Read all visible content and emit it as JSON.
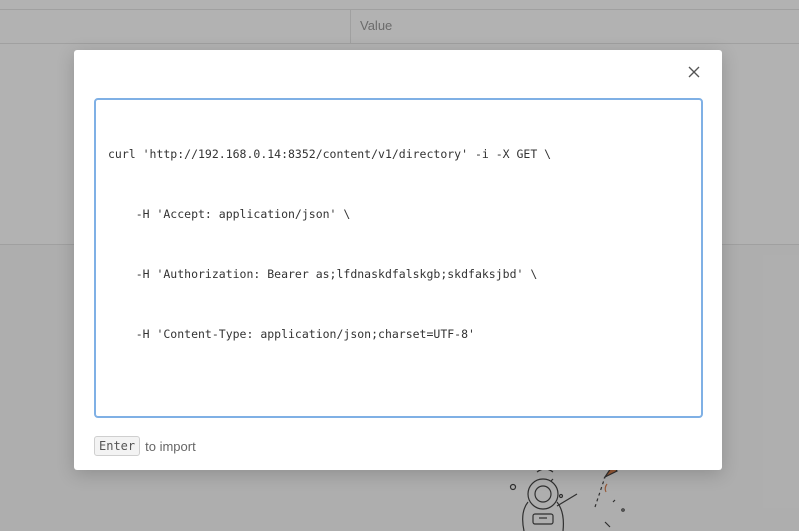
{
  "background": {
    "table_header_value": "Value"
  },
  "modal": {
    "close_icon": "close-icon",
    "editor_lines": [
      "curl 'http://192.168.0.14:8352/content/v1/directory' -i -X GET \\",
      "    -H 'Accept: application/json' \\",
      "    -H 'Authorization: Bearer as;lfdnaskdfalskgb;skdfaksjbd' \\",
      "    -H 'Content-Type: application/json;charset=UTF-8'"
    ],
    "hint_key": "Enter",
    "hint_text": "to import"
  },
  "colors": {
    "editor_border": "#7fb0e5",
    "illustration_accent": "#d9804f"
  }
}
